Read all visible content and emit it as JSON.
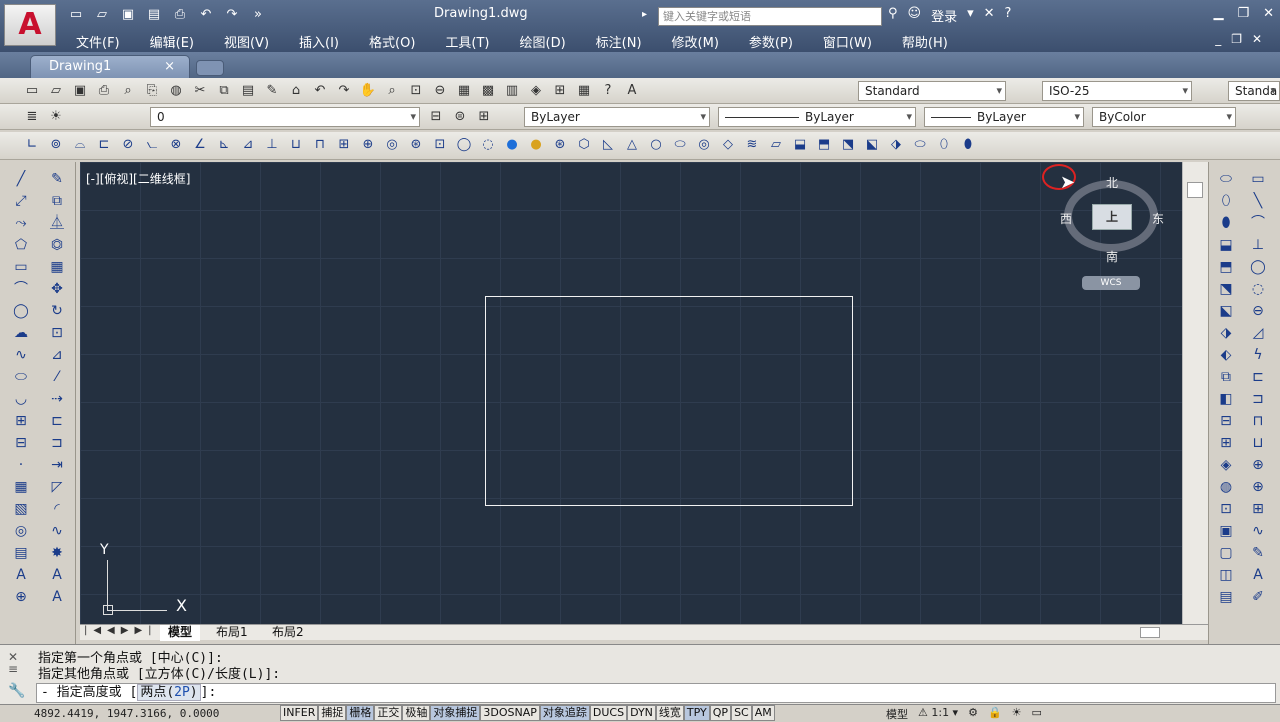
{
  "app": {
    "doc_title": "Drawing1.dwg",
    "search_placeholder": "键入关键字或短语",
    "login": "登录"
  },
  "menu": [
    "文件(F)",
    "编辑(E)",
    "视图(V)",
    "插入(I)",
    "格式(O)",
    "工具(T)",
    "绘图(D)",
    "标注(N)",
    "修改(M)",
    "参数(P)",
    "窗口(W)",
    "帮助(H)"
  ],
  "tabs": {
    "active": "Drawing1",
    "close": "×"
  },
  "toolbar": {
    "text_style": "Standard",
    "dim_style": "ISO-25",
    "table_style": "Standa",
    "layer": "0",
    "color": "ByLayer",
    "linetype": "ByLayer",
    "lineweight": "ByLayer",
    "plotstyle": "ByColor"
  },
  "viewport": {
    "label": "[-][俯视][二维线框]",
    "ucs_x": "X",
    "ucs_y": "Y"
  },
  "viewcube": {
    "north": "北",
    "south": "南",
    "east": "东",
    "west": "西",
    "face": "上",
    "wcs": "WCS"
  },
  "layout_tabs": [
    "模型",
    "布局1",
    "布局2"
  ],
  "command": {
    "line1": "指定第一个角点或 [中心(C)]:",
    "line2": "指定其他角点或 [立方体(C)/长度(L)]:",
    "prompt_prefix": "- 指定高度或 [",
    "prompt_option_label": "两点(",
    "prompt_option_key": "2P",
    "prompt_suffix": ")]:"
  },
  "status": {
    "coords": "4892.4419, 1947.3166, 0.0000",
    "buttons": [
      "INFER",
      "捕捉",
      "栅格",
      "正交",
      "极轴",
      "对象捕捉",
      "3DOSNAP",
      "对象追踪",
      "DUCS",
      "DYN",
      "线宽",
      "TPY",
      "QP",
      "SC",
      "AM"
    ],
    "model": "模型",
    "scale": "1:1"
  }
}
